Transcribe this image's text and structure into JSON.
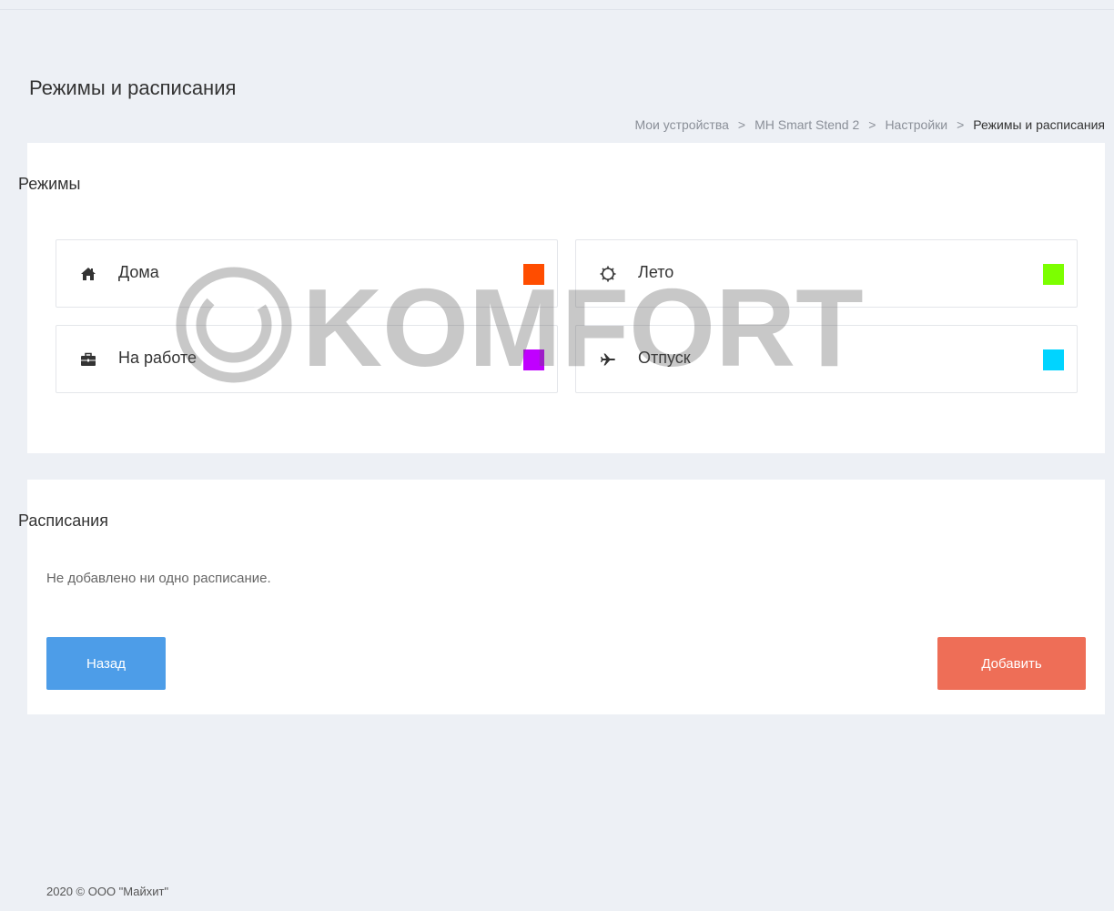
{
  "page": {
    "title": "Режимы и расписания",
    "breadcrumb": [
      "Мои устройства",
      "MH Smart Stend 2",
      "Настройки",
      "Режимы и расписания"
    ],
    "breadcrumb_separator": ">"
  },
  "modes_card": {
    "title": "Режимы",
    "items": [
      {
        "label": "Дома",
        "icon": "home-icon",
        "color": "#ff4d00"
      },
      {
        "label": "Лето",
        "icon": "sun-icon",
        "color": "#7cff00"
      },
      {
        "label": "На работе",
        "icon": "briefcase-icon",
        "color": "#c000ff"
      },
      {
        "label": "Отпуск",
        "icon": "airplane-icon",
        "color": "#00d4ff"
      }
    ]
  },
  "schedules_card": {
    "title": "Расписания",
    "empty_text": "Не добавлено ни одно расписание.",
    "back_button": "Назад",
    "add_button": "Добавить"
  },
  "watermark": {
    "text": "KOMFORT"
  },
  "footer": {
    "text": "2020 © ООО \"Майхит\""
  },
  "colors": {
    "background": "#edf0f5",
    "back_button": "#4d9de8",
    "add_button": "#ee6e57"
  }
}
